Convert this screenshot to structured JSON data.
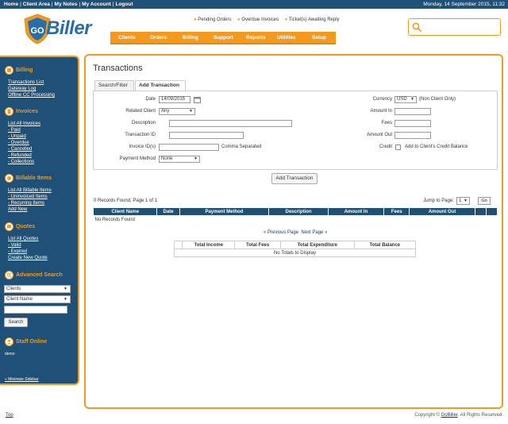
{
  "topbar": {
    "links": [
      "Home",
      "Client Area",
      "My Notes",
      "My Account",
      "Logout"
    ],
    "datetime": "Monday, 14 September 2015, 11:32"
  },
  "logo": {
    "part1": "GO",
    "part2": "Biller"
  },
  "notifications": [
    "Pending Orders",
    "Overdue Invoices",
    "Ticket(s) Awaiting Reply"
  ],
  "nav": [
    "Clients",
    "Orders",
    "Billing",
    "Support",
    "Reports",
    "Utilities",
    "Setup"
  ],
  "search": {
    "placeholder": ""
  },
  "sidebar": {
    "billing": {
      "title": "Billing",
      "links": [
        "Transactions List",
        "Gateway Log",
        "Offline CC Processing"
      ]
    },
    "invoices": {
      "title": "Invoices",
      "links": [
        "List All Invoices",
        "- Paid",
        "- Unpaid",
        "- Overdue",
        "- Cancelled",
        "- Refunded",
        "- Collections"
      ]
    },
    "billable": {
      "title": "Billable Items",
      "links": [
        "List All Billable Items",
        "- Uninvoiced Items",
        "- Recurring Items",
        "Add New"
      ]
    },
    "quotes": {
      "title": "Quotes",
      "links": [
        "List All Quotes",
        "- Valid",
        "- Expired",
        "Create New Quote"
      ]
    },
    "advanced": {
      "title": "Advanced Search",
      "select1": "Clients",
      "select2": "Client Name",
      "button": "Search"
    },
    "staff": {
      "title": "Staff Online",
      "user": "demo"
    },
    "minimise": "« Minimise Sidebar"
  },
  "main": {
    "title": "Transactions",
    "tabs": [
      "Search/Filter",
      "Add Transaction"
    ],
    "form": {
      "date_label": "Date",
      "date_value": "14/09/2015",
      "client_label": "Related Client",
      "client_value": "Any",
      "description_label": "Description",
      "txid_label": "Transaction ID",
      "invoices_label": "Invoice ID(s)",
      "invoices_hint": "Comma Separated",
      "method_label": "Payment Method",
      "method_value": "None",
      "currency_label": "Currency",
      "currency_value": "USD",
      "currency_hint": "(Non Client Only)",
      "amount_in_label": "Amount In",
      "fees_label": "Fees",
      "amount_out_label": "Amount Out",
      "credit_label": "Credit",
      "credit_hint": "Add to Client's Credit Balance"
    },
    "add_button": "Add Transaction",
    "records_info": "0 Records Found, Page 1 of 1",
    "jump_label": "Jump to Page:",
    "jump_value": "1",
    "go_label": "Go",
    "table": {
      "headers": [
        "Client Name",
        "Date",
        "Payment Method",
        "Description",
        "Amount In",
        "Fees",
        "Amount Out"
      ],
      "empty": "No Records Found"
    },
    "pager": {
      "prev": "« Previous Page",
      "next": "Next Page »"
    },
    "totals": {
      "headers": [
        "Total Income",
        "Total Fees",
        "Total Expenditure",
        "Total Balance"
      ],
      "empty": "No Totals to Display"
    }
  },
  "footer": {
    "top": "Top",
    "copyright": "Copyright © ",
    "company": "GoBiller",
    "rights": ". All Rights Reserved."
  },
  "colors": {
    "navy": "#1f5077",
    "orange": "#f39a1e"
  }
}
